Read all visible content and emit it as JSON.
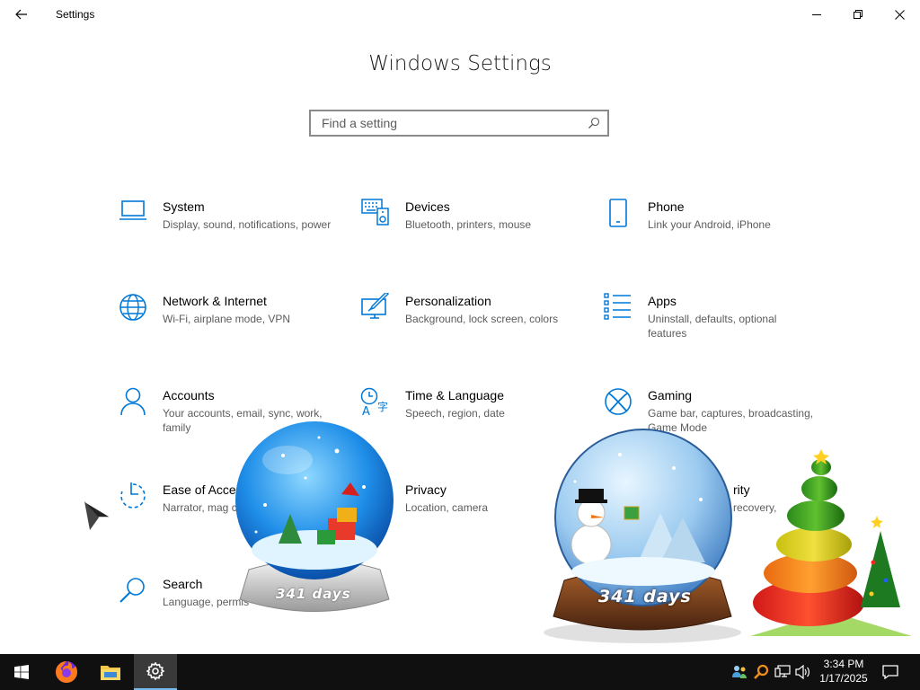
{
  "window": {
    "title": "Settings",
    "back_icon": "arrow-left-icon",
    "controls": [
      "minimize-icon",
      "maximize-icon",
      "close-icon"
    ]
  },
  "main": {
    "heading": "Windows Settings",
    "search": {
      "placeholder": "Find a setting",
      "value": "",
      "icon": "search-icon"
    }
  },
  "tiles": [
    {
      "id": "system",
      "name": "System",
      "desc": "Display, sound, notifications, power",
      "icon": "laptop-icon"
    },
    {
      "id": "devices",
      "name": "Devices",
      "desc": "Bluetooth, printers, mouse",
      "icon": "keyboard-speaker-icon"
    },
    {
      "id": "phone",
      "name": "Phone",
      "desc": "Link your Android, iPhone",
      "icon": "phone-icon"
    },
    {
      "id": "network",
      "name": "Network & Internet",
      "desc": "Wi-Fi, airplane mode, VPN",
      "icon": "globe-icon"
    },
    {
      "id": "personalization",
      "name": "Personalization",
      "desc": "Background, lock screen, colors",
      "icon": "paintbrush-monitor-icon"
    },
    {
      "id": "apps",
      "name": "Apps",
      "desc": "Uninstall, defaults, optional features",
      "icon": "app-list-icon"
    },
    {
      "id": "accounts",
      "name": "Accounts",
      "desc": "Your accounts, email, sync, work, family",
      "icon": "person-icon"
    },
    {
      "id": "time",
      "name": "Time & Language",
      "desc": "Speech, region, date",
      "icon": "time-language-icon"
    },
    {
      "id": "gaming",
      "name": "Gaming",
      "desc": "Game bar, captures, broadcasting, Game Mode",
      "icon": "xbox-icon"
    },
    {
      "id": "ease",
      "name": "Ease of Acce",
      "desc": "Narrator, mag contrast",
      "icon": "ease-of-access-icon"
    },
    {
      "id": "privacy",
      "name": "Privacy",
      "desc": "Location, camera",
      "icon": "lock-icon"
    },
    {
      "id": "update",
      "name": "rity",
      "desc": "recovery,",
      "icon": "update-icon"
    },
    {
      "id": "search",
      "name": "Search",
      "desc": "Language, permis",
      "icon": "magnifier-icon"
    }
  ],
  "gadgets": {
    "snowglobe_blue_caption": "341 days",
    "snowglobe_brown_caption": "341 days",
    "tree_icon": "christmas-tree-icon"
  },
  "taskbar": {
    "start_icon": "windows-logo-icon",
    "pinned": [
      {
        "name": "firefox",
        "icon": "firefox-icon"
      },
      {
        "name": "file-explorer",
        "icon": "folder-icon"
      },
      {
        "name": "settings",
        "icon": "gear-icon",
        "active": true
      }
    ],
    "tray_icons": [
      "people-icon",
      "search-tool-icon",
      "network-icon",
      "volume-icon"
    ],
    "time": "3:34 PM",
    "date": "1/17/2025",
    "notification_icon": "notification-icon"
  },
  "colors": {
    "accent": "#0078d7",
    "taskbar_bg": "#101010",
    "description_text": "#5c5c5c"
  }
}
